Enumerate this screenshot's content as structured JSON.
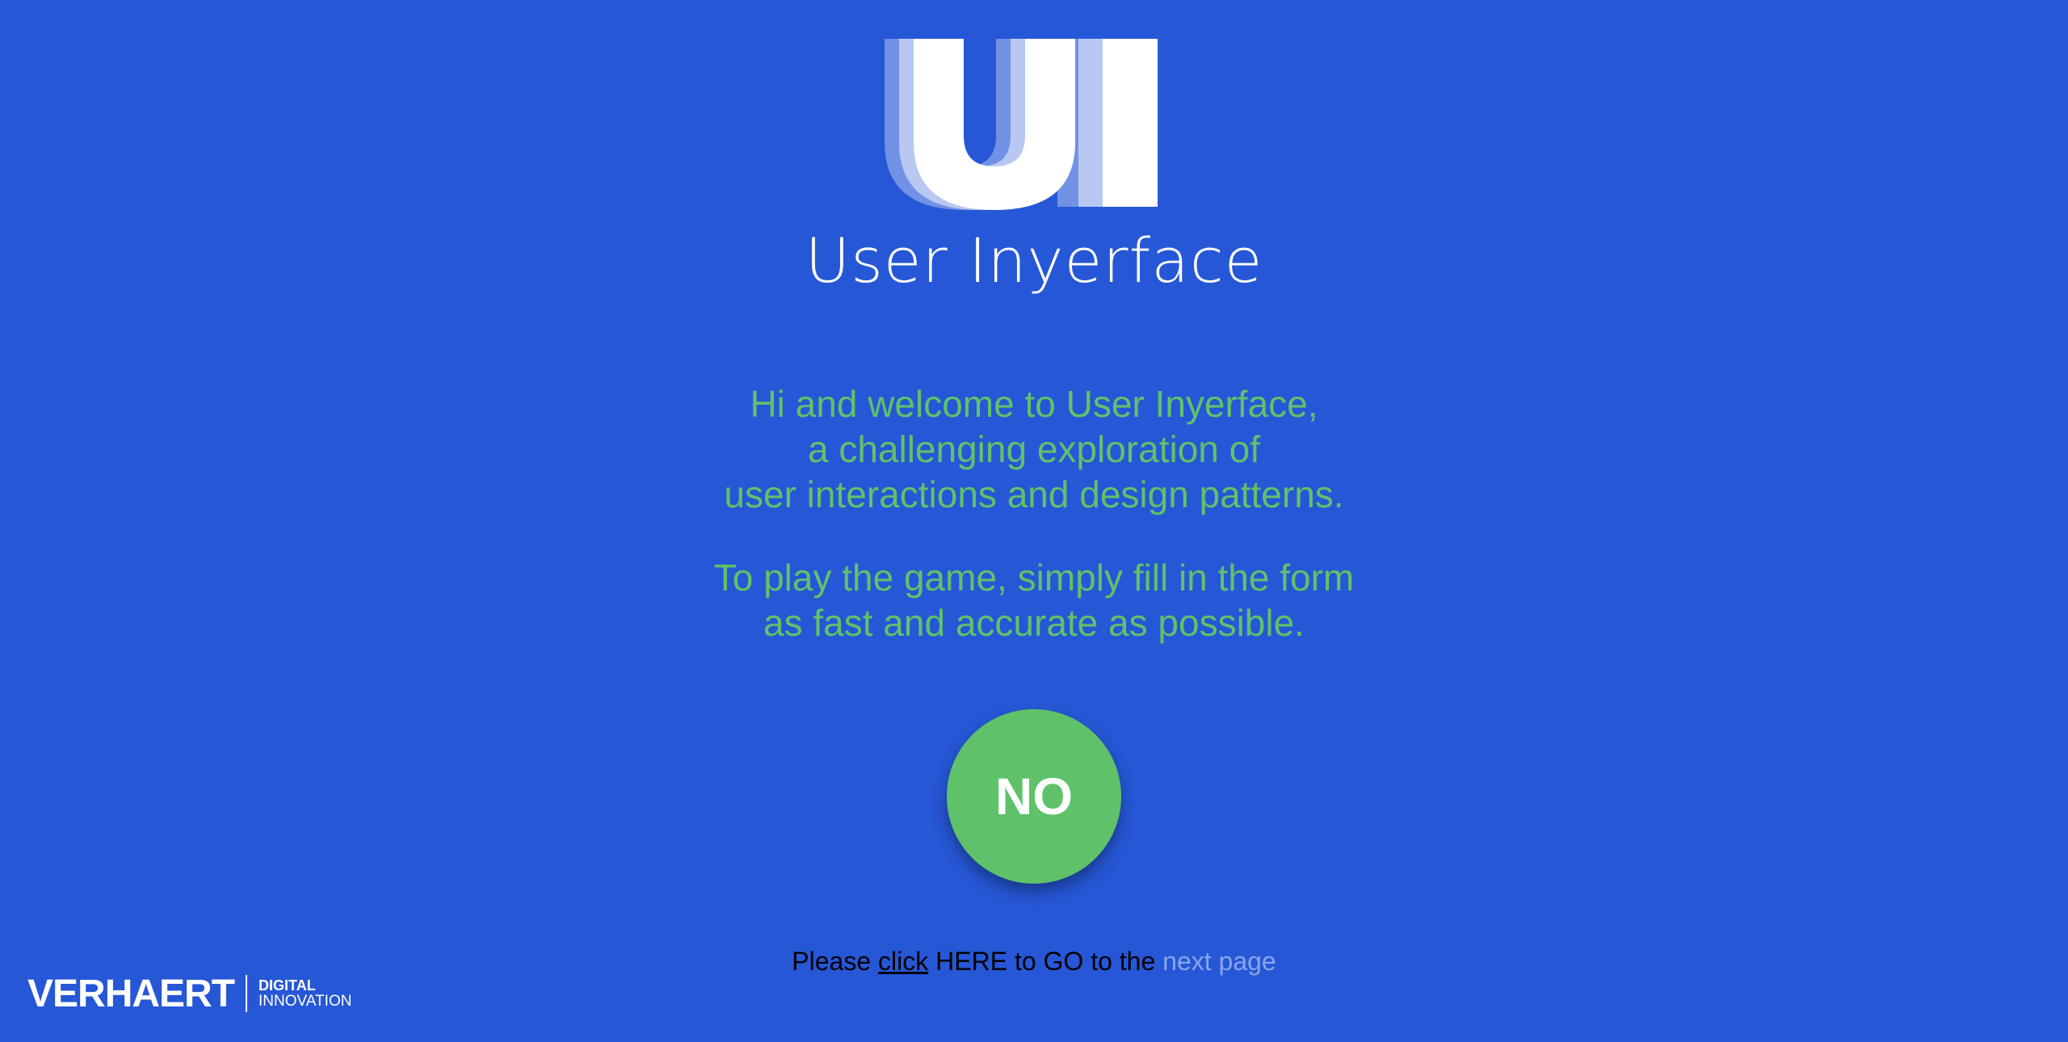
{
  "app": {
    "logo_text": "UI",
    "title": "User Inyerface"
  },
  "intro": {
    "paragraph1": [
      "Hi and welcome to User Inyerface,",
      "a challenging exploration of",
      "user interactions and design patterns."
    ],
    "paragraph2": [
      "To play the game, simply fill in the form",
      "as fast and accurate as possible."
    ]
  },
  "primary_button": {
    "label": "NO"
  },
  "footer": {
    "prefix": "Please ",
    "click_link": "click",
    "middle": " HERE to GO to the ",
    "next_page_link": "next page"
  },
  "brand": {
    "name": "VERHAERT",
    "line1": "DIGITAL",
    "line2": "INNOVATION"
  },
  "colors": {
    "background": "#2657d6",
    "accent_green": "#5fc26a",
    "white": "#ffffff",
    "muted_link": "#8aa4ec"
  }
}
